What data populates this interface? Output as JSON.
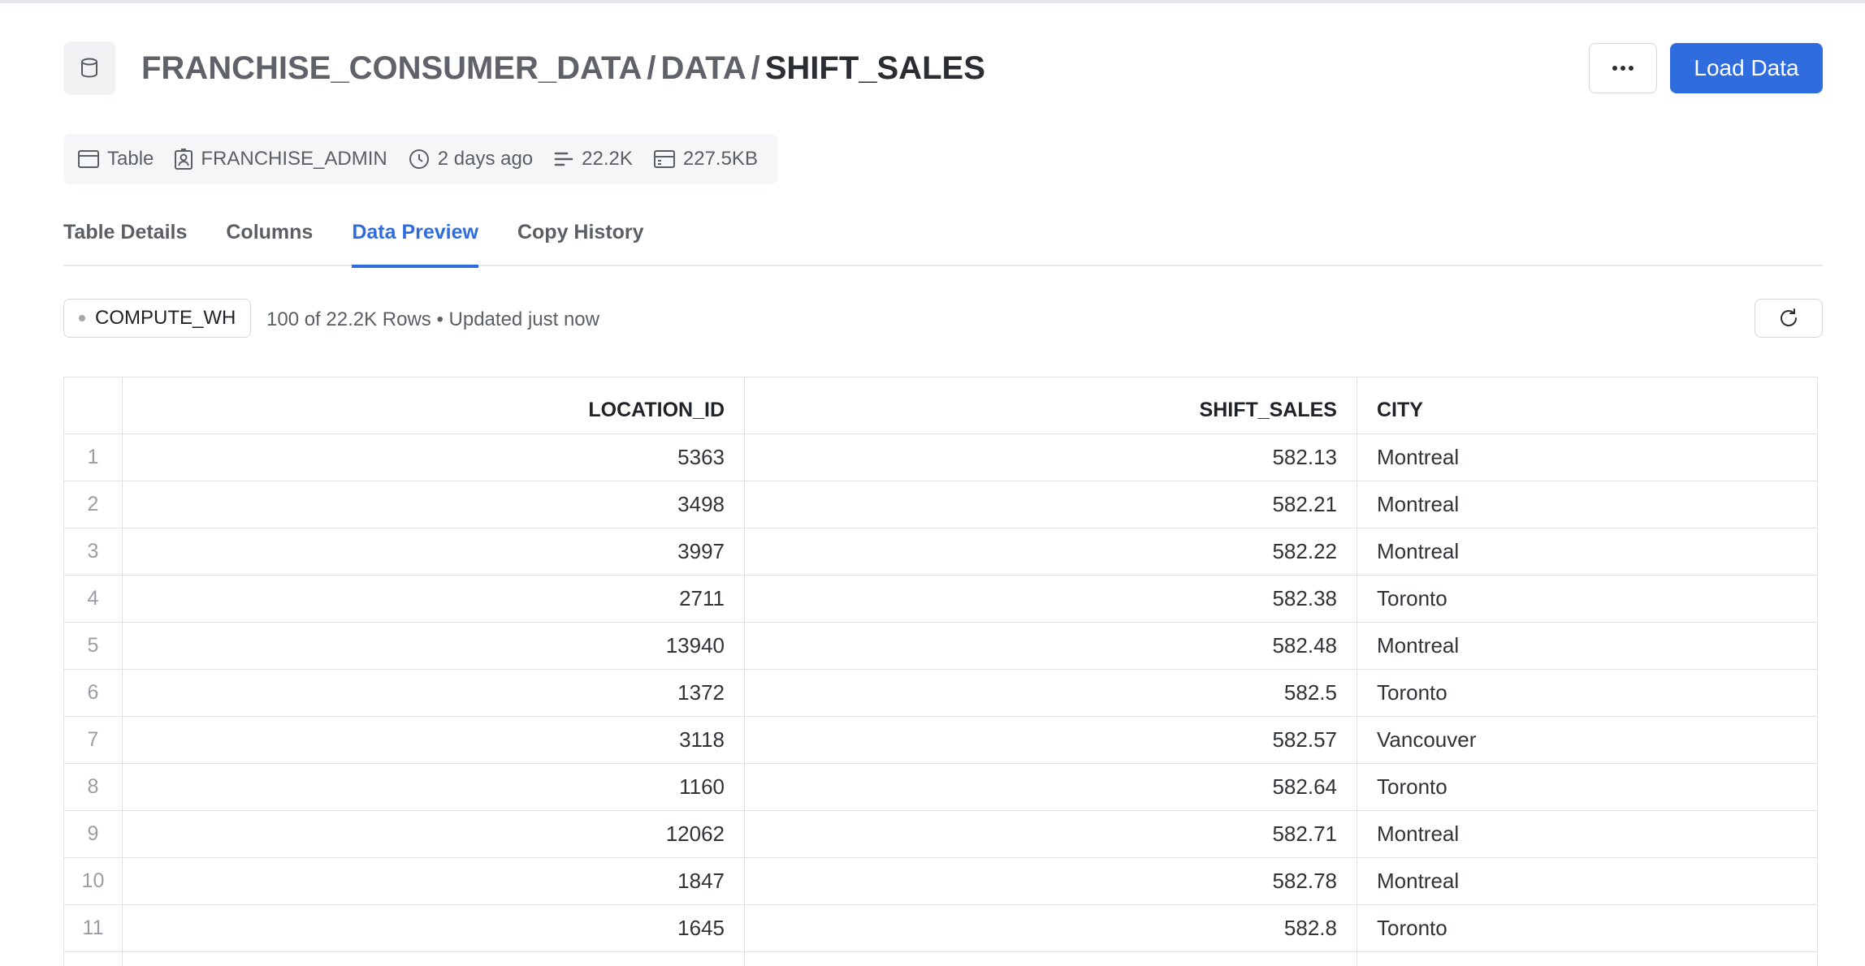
{
  "header": {
    "breadcrumb": [
      "FRANCHISE_CONSUMER_DATA",
      "DATA"
    ],
    "separator": "/",
    "current": "SHIFT_SALES",
    "more_icon": "ellipsis-icon",
    "load_button": "Load Data",
    "accent_color": "#2f6ddf"
  },
  "meta": {
    "type": "Table",
    "owner": "FRANCHISE_ADMIN",
    "modified": "2 days ago",
    "rows": "22.2K",
    "size": "227.5KB"
  },
  "tabs": [
    {
      "label": "Table Details",
      "active": false
    },
    {
      "label": "Columns",
      "active": false
    },
    {
      "label": "Data Preview",
      "active": true
    },
    {
      "label": "Copy History",
      "active": false
    }
  ],
  "toolbar": {
    "warehouse": "COMPUTE_WH",
    "row_info": "100 of 22.2K Rows • Updated just now",
    "refresh_icon": "refresh-icon"
  },
  "table": {
    "columns": [
      "LOCATION_ID",
      "SHIFT_SALES",
      "CITY"
    ],
    "rows": [
      {
        "idx": "1",
        "location_id": "5363",
        "shift_sales": "582.13",
        "city": "Montreal"
      },
      {
        "idx": "2",
        "location_id": "3498",
        "shift_sales": "582.21",
        "city": "Montreal"
      },
      {
        "idx": "3",
        "location_id": "3997",
        "shift_sales": "582.22",
        "city": "Montreal"
      },
      {
        "idx": "4",
        "location_id": "2711",
        "shift_sales": "582.38",
        "city": "Toronto"
      },
      {
        "idx": "5",
        "location_id": "13940",
        "shift_sales": "582.48",
        "city": "Montreal"
      },
      {
        "idx": "6",
        "location_id": "1372",
        "shift_sales": "582.5",
        "city": "Toronto"
      },
      {
        "idx": "7",
        "location_id": "3118",
        "shift_sales": "582.57",
        "city": "Vancouver"
      },
      {
        "idx": "8",
        "location_id": "1160",
        "shift_sales": "582.64",
        "city": "Toronto"
      },
      {
        "idx": "9",
        "location_id": "12062",
        "shift_sales": "582.71",
        "city": "Montreal"
      },
      {
        "idx": "10",
        "location_id": "1847",
        "shift_sales": "582.78",
        "city": "Montreal"
      },
      {
        "idx": "11",
        "location_id": "1645",
        "shift_sales": "582.8",
        "city": "Toronto"
      },
      {
        "idx": "",
        "location_id": "",
        "shift_sales": "",
        "city": ""
      }
    ]
  }
}
